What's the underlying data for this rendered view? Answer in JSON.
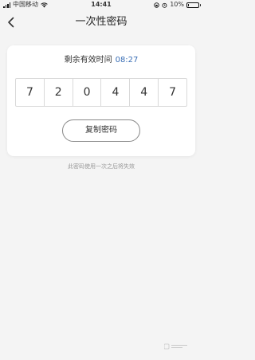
{
  "status_bar": {
    "carrier": "中国移动",
    "time": "14:41",
    "battery_percent": "10%",
    "battery_level": 0.1,
    "icons": [
      "signal-icon",
      "wifi-icon",
      "lock-rotation-icon",
      "alarm-icon",
      "battery-icon"
    ]
  },
  "nav": {
    "title": "一次性密码",
    "back_icon": "chevron-left-icon"
  },
  "card": {
    "timer_label": "剩余有效时间",
    "timer_value": "08:27",
    "digits": [
      "7",
      "2",
      "0",
      "4",
      "4",
      "7"
    ],
    "copy_button_label": "复制密码"
  },
  "hint": "此密码使用一次之后将失效",
  "colors": {
    "accent": "#3b6fb6",
    "background": "#f4f4f4",
    "card": "#ffffff"
  }
}
